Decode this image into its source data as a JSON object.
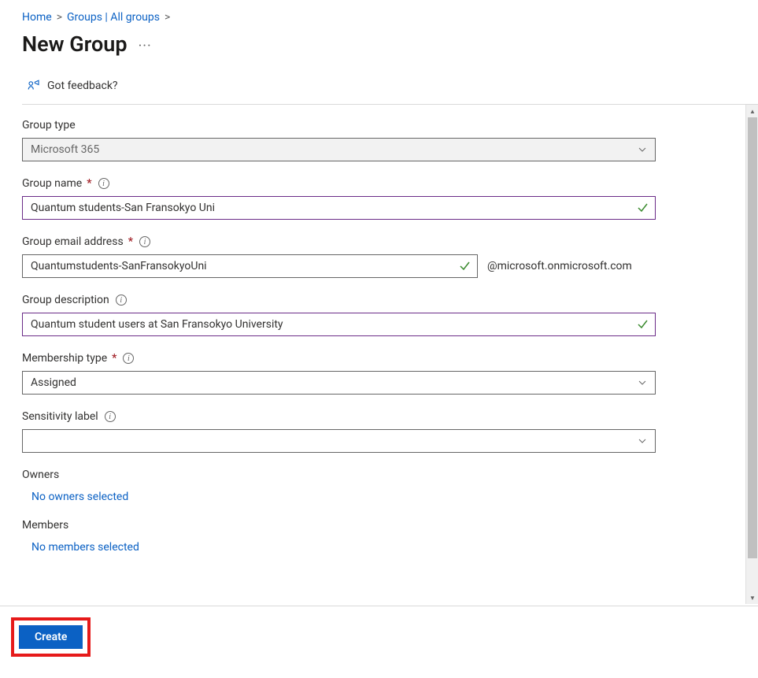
{
  "breadcrumb": {
    "home": "Home",
    "groups": "Groups | All groups"
  },
  "page": {
    "title": "New Group",
    "more": "···"
  },
  "feedback": {
    "label": "Got feedback?"
  },
  "fields": {
    "group_type": {
      "label": "Group type",
      "value": "Microsoft 365"
    },
    "group_name": {
      "label": "Group name",
      "value": "Quantum students-San Fransokyo Uni"
    },
    "group_email": {
      "label": "Group email address",
      "value": "Quantumstudents-SanFransokyoUni",
      "suffix": "@microsoft.onmicrosoft.com"
    },
    "group_description": {
      "label": "Group description",
      "value": "Quantum student users at San Fransokyo University"
    },
    "membership_type": {
      "label": "Membership type",
      "value": "Assigned"
    },
    "sensitivity_label": {
      "label": "Sensitivity label",
      "value": ""
    }
  },
  "owners": {
    "label": "Owners",
    "link": "No owners selected"
  },
  "members": {
    "label": "Members",
    "link": "No members selected"
  },
  "footer": {
    "create": "Create"
  },
  "required_marker": "*"
}
